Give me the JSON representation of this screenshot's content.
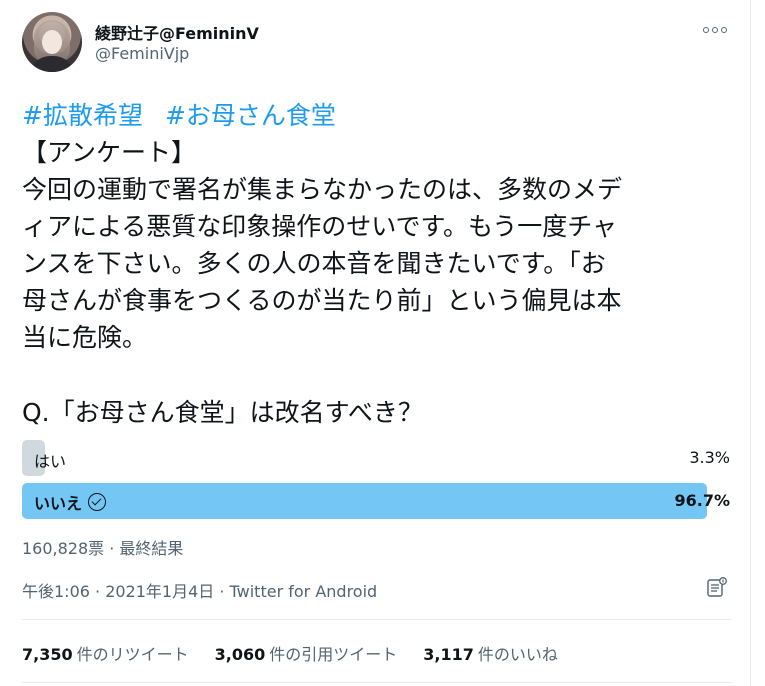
{
  "user": {
    "display_name": "綾野辻子@FemininV",
    "handle": "@FeminiVjp"
  },
  "tweet": {
    "hashtags": [
      "#拡散希望",
      "#お母さん食堂"
    ],
    "lines": [
      "【アンケート】",
      "今回の運動で署名が集まらなかったのは、多数のメデ",
      "ィアによる悪質な印象操作のせいです。もう一度チャ",
      "ンスを下さい。多くの人の本音を聞きたいです。「お",
      "母さんが食事をつくるのが当たり前」という偏見は本",
      "当に危険。"
    ]
  },
  "poll": {
    "question": "Q.「お母さん食堂」は改名すべき？",
    "options": [
      {
        "label": "はい",
        "percent": "3.3%",
        "value": 3.3
      },
      {
        "label": "いいえ",
        "percent": "96.7%",
        "value": 96.7,
        "winner": true
      }
    ],
    "summary": "160,828票 · 最終結果"
  },
  "meta": {
    "timestamp": "午後1:06 · 2021年1月4日 · Twitter for Android"
  },
  "stats": {
    "retweets": {
      "count": "7,350",
      "label": "件のリツイート"
    },
    "quotes": {
      "count": "3,060",
      "label": "件の引用ツイート"
    },
    "likes": {
      "count": "3,117",
      "label": "件のいいね"
    }
  },
  "icons": {
    "more": "more-icon",
    "check": "check-circle-icon",
    "analytics": "analytics-icon"
  },
  "colors": {
    "link": "#1d9bf0",
    "poll_winner": "#74c6f5",
    "poll_other": "#cfd9de",
    "secondary_text": "#536471"
  }
}
